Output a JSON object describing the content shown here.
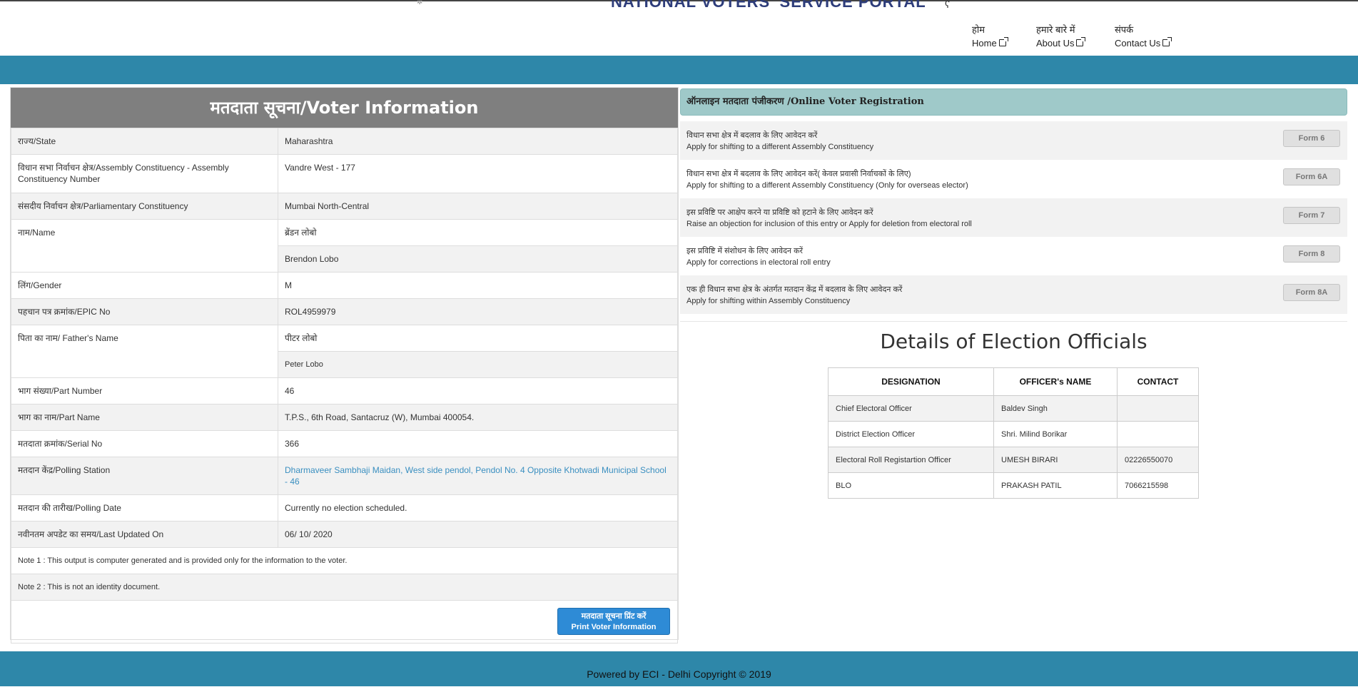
{
  "header": {
    "portal_title": "NATIONAL VOTERS' SERVICE PORTAL",
    "nav": [
      {
        "hi": "होम",
        "en": "Home"
      },
      {
        "hi": "हमारे बारे में",
        "en": "About Us"
      },
      {
        "hi": "संपर्क",
        "en": "Contact Us"
      }
    ]
  },
  "voter": {
    "heading": "मतदाता सूचना/Voter Information",
    "rows": {
      "state": {
        "label": "राज्य/State",
        "value": "Maharashtra"
      },
      "ac": {
        "label": "विधान सभा निर्वाचन क्षेत्र/Assembly Constituency - Assembly Constituency Number",
        "value": "Vandre West - 177"
      },
      "pc": {
        "label": "संसदीय निर्वाचन क्षेत्र/Parliamentary Constituency",
        "value": "Mumbai North-Central"
      },
      "name": {
        "label": "नाम/Name",
        "value_hi": "ब्रेंडन लोबो",
        "value_en": "Brendon Lobo"
      },
      "gender": {
        "label": "लिंग/Gender",
        "value": "M"
      },
      "epic": {
        "label": "पहचान पत्र क्रमांक/EPIC No",
        "value": "ROL4959979"
      },
      "father": {
        "label": "पिता का नाम/ Father's Name",
        "value_hi": "पीटर लोबो",
        "value_en": "Peter Lobo"
      },
      "part_no": {
        "label": "भाग संख्या/Part Number",
        "value": "46"
      },
      "part_name": {
        "label": "भाग का नाम/Part Name",
        "value": "T.P.S., 6th Road, Santacruz (W), Mumbai 400054."
      },
      "serial": {
        "label": "मतदाता क्रमांक/Serial No",
        "value": "366"
      },
      "polling_station": {
        "label": "मतदान केंद्र/Polling Station",
        "value": "Dharmaveer Sambhaji Maidan, West side pendol, Pendol No. 4 Opposite Khotwadi Municipal School - 46"
      },
      "polling_date": {
        "label": "मतदान की तारीख/Polling Date",
        "value": "Currently no election scheduled."
      },
      "updated": {
        "label": "नवीनतम अपडेट का समय/Last Updated On",
        "value": "06/ 10/ 2020"
      }
    },
    "note1": "Note 1 : This output is computer generated and is provided only for the information to the voter.",
    "note2": "Note 2 : This is not an identity document.",
    "print_hi": "मतदाता सूचना प्रिंट करें",
    "print_en": "Print Voter Information"
  },
  "registration": {
    "heading": "ऑनलाइन मतदाता पंजीकरण /Online Voter Registration",
    "forms": [
      {
        "hi": "विधान सभा क्षेत्र में बदलाव के लिए आवेदन करें",
        "en": "Apply for shifting to a different Assembly Constituency",
        "button": "Form 6"
      },
      {
        "hi": "विधान सभा क्षेत्र में बदलाव के लिए आवेदन करें( केवल प्रवासी निर्वाचकों के लिए)",
        "en": "Apply for shifting to a different Assembly Constituency (Only for overseas elector)",
        "button": "Form 6A"
      },
      {
        "hi": "इस प्रविष्टि पर आक्षेप करने या प्रविष्टि को हटाने के लिए आवेदन करें",
        "en": "Raise an objection for inclusion of this entry or Apply for deletion from electoral roll",
        "button": "Form 7"
      },
      {
        "hi": "इस प्रविष्टि में संशोधन के लिए आवेदन करें",
        "en": "Apply for corrections in electoral roll entry",
        "button": "Form 8"
      },
      {
        "hi": "एक ही विधान सभा क्षेत्र के अंतर्गत मतदान केंद्र में बदलाव के लिए आवेदन करें",
        "en": "Apply for shifting within Assembly Constituency",
        "button": "Form 8A"
      }
    ]
  },
  "officials": {
    "title": "Details of Election Officials",
    "columns": [
      "DESIGNATION",
      "OFFICER's NAME",
      "CONTACT"
    ],
    "rows": [
      [
        "Chief Electoral Officer",
        "Baldev Singh",
        ""
      ],
      [
        "District Election Officer",
        "Shri. Milind Borikar",
        ""
      ],
      [
        "Electoral Roll Registartion Officer",
        "UMESH BIRARI",
        "02226550070"
      ],
      [
        "BLO",
        "PRAKASH PATIL",
        "7066215598"
      ]
    ]
  },
  "footer": "Powered by ECI - Delhi Copyright © 2019"
}
